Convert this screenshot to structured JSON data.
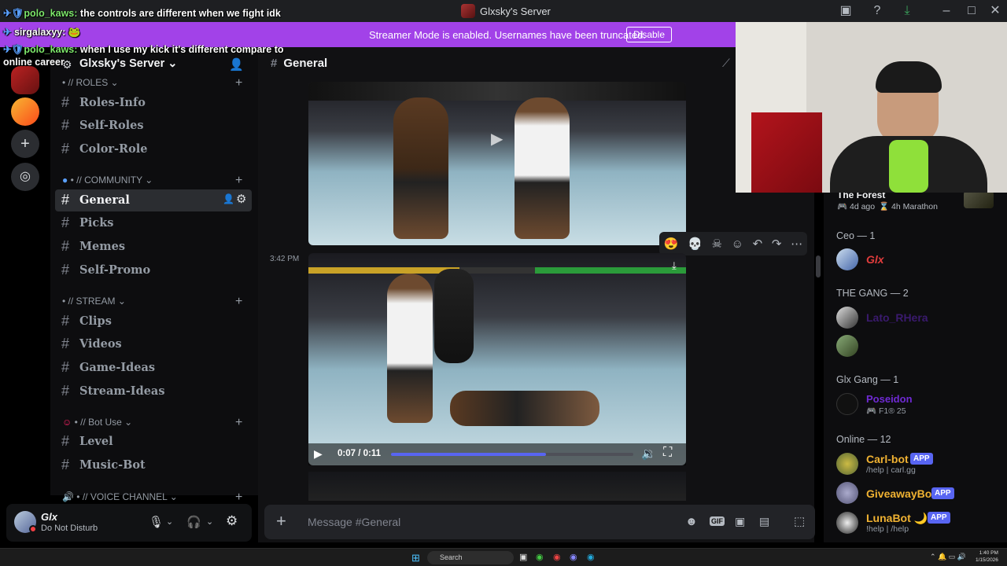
{
  "window": {
    "title": "Glxsky's Server"
  },
  "banner": {
    "message": "Streamer Mode is enabled. Usernames have been truncated.",
    "disable_label": "Disable"
  },
  "chat_overlay": [
    {
      "user": "polo_kaws:",
      "text": "the controls are different when we fight idk"
    },
    {
      "user": "sirgalaxyy:",
      "text": "🐸"
    },
    {
      "user": "polo_kaws:",
      "text": "when I use my kick it's different compare to"
    },
    {
      "user": "",
      "text": "online career"
    }
  ],
  "server": {
    "name": "Glxsky's Server"
  },
  "categories": {
    "roles": "• // ROLES",
    "community": "• // COMMUNITY",
    "stream": "• // STREAM",
    "bot": "• // Bot Use",
    "voice": "• // VOICE CHANNEL"
  },
  "channels": {
    "roles_info": "Roles-Info",
    "self_roles": "Self-Roles",
    "color_role": "Color-Role",
    "general": "General",
    "picks": "Picks",
    "memes": "Memes",
    "self_promo": "Self-Promo",
    "clips": "Clips",
    "videos": "Videos",
    "game_ideas": "Game-Ideas",
    "stream_ideas": "Stream-Ideas",
    "level": "Level",
    "music_bot": "Music-Bot"
  },
  "user": {
    "name": "Glx",
    "status": "Do Not Disturb"
  },
  "header": {
    "channel": "General"
  },
  "message": {
    "timestamp": "3:42 PM"
  },
  "video": {
    "time": "0:07 / 0:11",
    "progress": 0.64
  },
  "composer": {
    "placeholder": "Message #General"
  },
  "members": {
    "activity_title": "The Forest",
    "activity_time": "4d ago",
    "activity_badge": "4h Marathon",
    "ceo_header": "Ceo — 1",
    "ceo_member": "Glx",
    "gang_header": "THE GANG — 2",
    "gang_member": "Lato_RHera",
    "glxgang_header": "Glx Gang — 1",
    "glxgang_member": "Poseidon",
    "glxgang_sub": "F1® 25",
    "online_header": "Online — 12",
    "bots": [
      {
        "name": "Carl-bot",
        "sub": "/help | carl.gg",
        "badge": "APP"
      },
      {
        "name": "GiveawayBot",
        "sub": "",
        "badge": "APP"
      },
      {
        "name": "LunaBot 🌙",
        "sub": "!help | /help",
        "badge": "APP"
      }
    ]
  },
  "taskbar": {
    "search": "Search",
    "time": "1:40 PM",
    "date": "1/15/2026"
  },
  "colors": {
    "accent": "#5865f2",
    "banner": "#a242e8",
    "ceo": "#e03c3c",
    "gang": "#6f2ad4",
    "bot": "#f0b232"
  }
}
